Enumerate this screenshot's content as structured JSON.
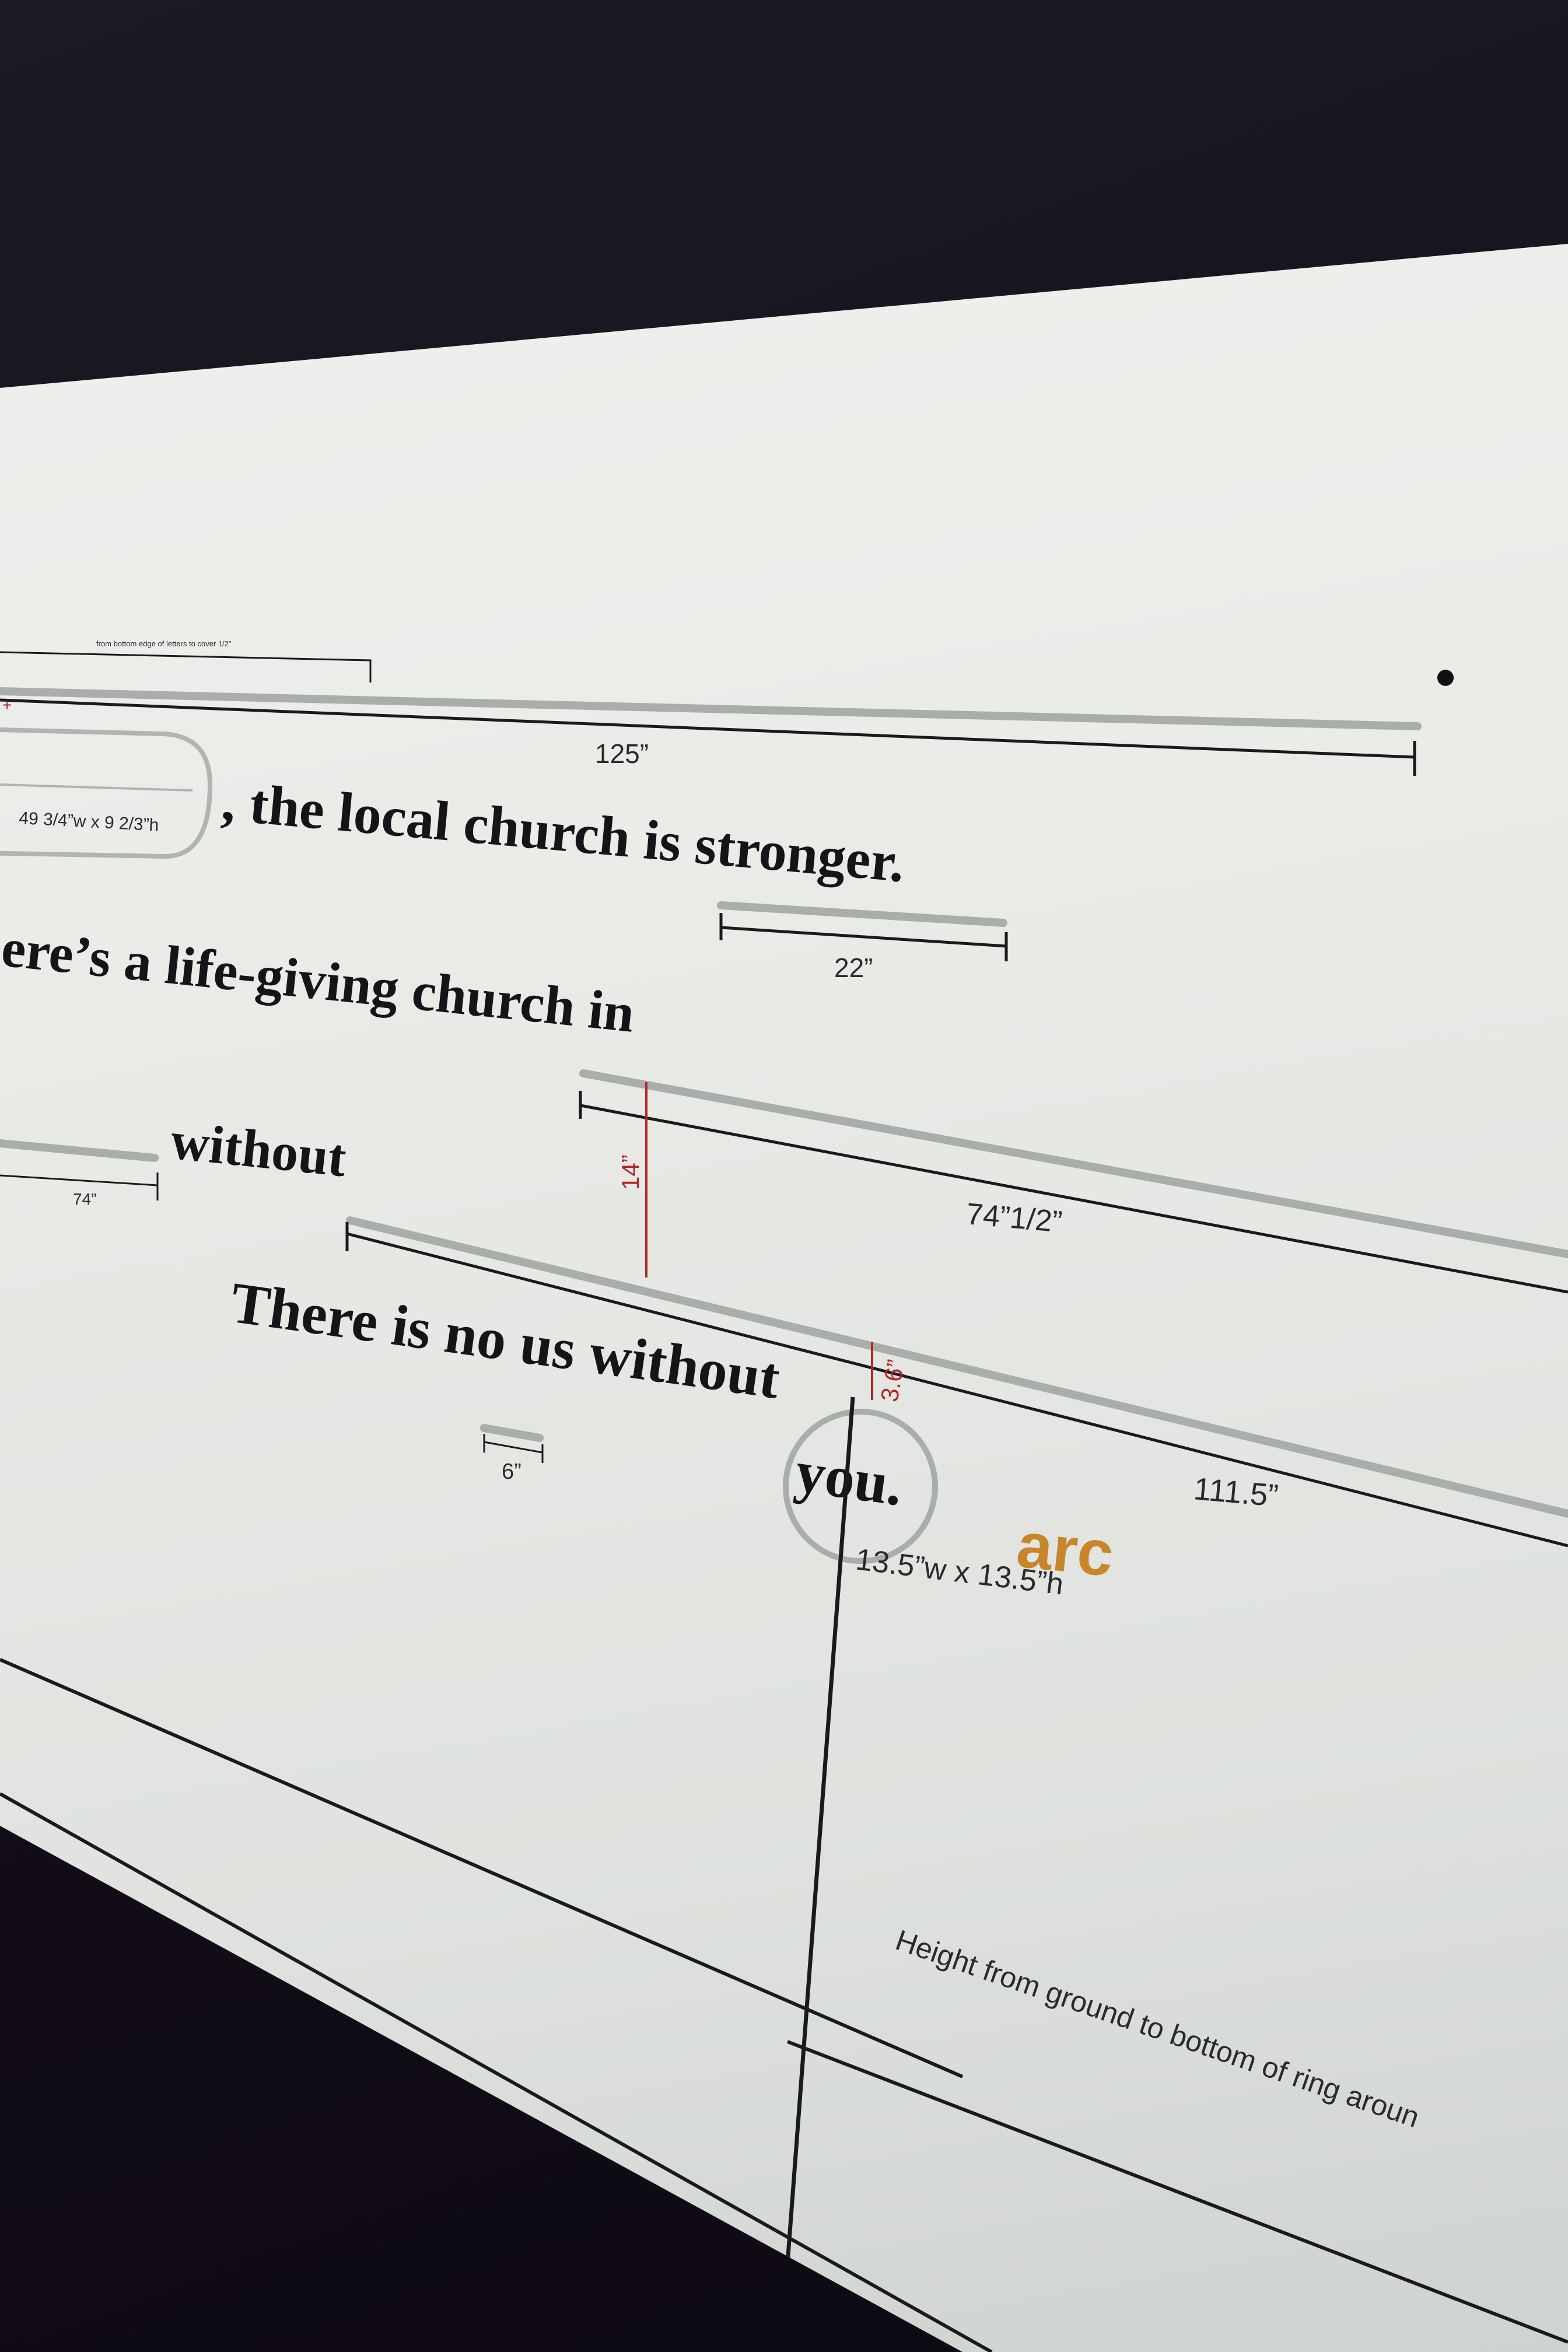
{
  "signage_text": {
    "line1": ", the local church is stronger.",
    "line2": "ere’s a life-giving church in",
    "line3": "without",
    "line4_start": "There is no us without",
    "line4_end": "you."
  },
  "measurements": {
    "tiny_note": "from bottom edge of letters to cover 1/2\"",
    "width_125": "125”",
    "pill_size": "49 3/4”w x 9 2/3”h",
    "width_22": "22”",
    "height_14": "14”",
    "width_74_small": "74”",
    "width_74_half": "74”1/2”",
    "height_3_6": "3.6”",
    "width_111_5": "111.5”",
    "width_6": "6”",
    "ring_size": "13.5”w x 13.5”h",
    "ground_note": "Height from ground to bottom of ring aroun"
  },
  "logo": {
    "text": "arc",
    "color": "#c8862a"
  },
  "colors": {
    "red_dimension": "#b3262c",
    "ink": "#161418",
    "screen": "#eceeea"
  }
}
